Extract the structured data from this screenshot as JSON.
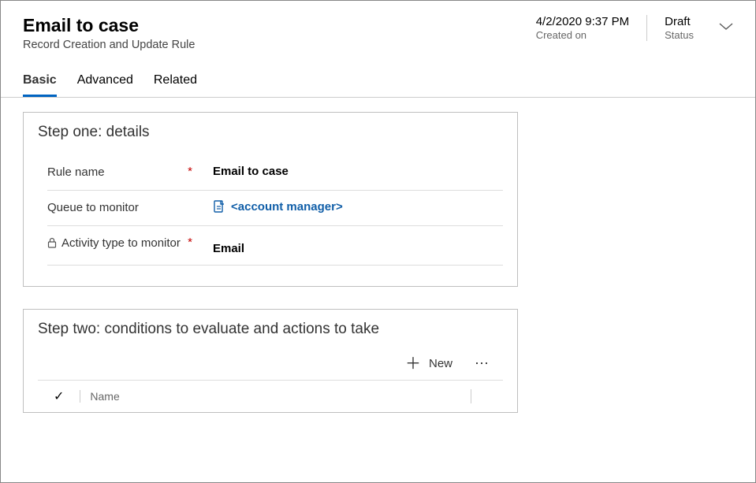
{
  "header": {
    "title": "Email to case",
    "subtitle": "Record Creation and Update Rule",
    "created_on_value": "4/2/2020 9:37 PM",
    "created_on_label": "Created on",
    "status_value": "Draft",
    "status_label": "Status"
  },
  "tabs": {
    "basic": "Basic",
    "advanced": "Advanced",
    "related": "Related"
  },
  "step_one": {
    "title": "Step one: details",
    "fields": {
      "rule_name": {
        "label": "Rule name",
        "value": "Email to case"
      },
      "queue": {
        "label": "Queue to monitor",
        "value": "<account manager>"
      },
      "activity_type": {
        "label": "Activity type to monitor",
        "value": "Email"
      }
    }
  },
  "step_two": {
    "title": "Step two: conditions to evaluate and actions to take",
    "new_button": "New",
    "grid_column_name": "Name"
  }
}
